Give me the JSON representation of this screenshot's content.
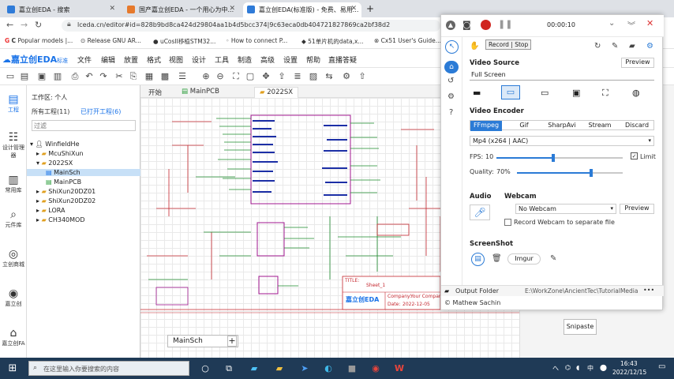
{
  "browser": {
    "tabs": [
      {
        "title": "嘉立创EDA - 搜索"
      },
      {
        "title": "国产嘉立创EDA - 一个用心为中..."
      },
      {
        "title": "嘉立创EDA(标准版) - 免费、易用..."
      }
    ],
    "new_tab": "+",
    "address": "lceda.cn/editor#id=828b9bd8ca424d29804aa1b4d5bcc374|9c63eca0db4047218278​69ca2bf38d2",
    "bookmarks": [
      "Popular models |...",
      "Release GNU AR...",
      "uCosII移植STM32...",
      "How to connect P...",
      "51单片机的data,x...",
      "Cx51 User's Guide..."
    ]
  },
  "eda": {
    "logo": "嘉立创EDA",
    "logo_tag": "标准",
    "menu": [
      "文件",
      "编辑",
      "放置",
      "格式",
      "视图",
      "设计",
      "工具",
      "制造",
      "高级",
      "设置",
      "帮助",
      "直播答疑"
    ],
    "rail": [
      {
        "label": "工程",
        "icon": "folder-icon"
      },
      {
        "label": "设计管理器",
        "icon": "list-icon"
      },
      {
        "label": "常用库",
        "icon": "library-icon"
      },
      {
        "label": "元件库",
        "icon": "search-icon"
      },
      {
        "label": "立创商城",
        "icon": "store-icon"
      },
      {
        "label": "嘉立创",
        "icon": "jlc-icon"
      },
      {
        "label": "嘉立创FA",
        "icon": "factory-icon"
      }
    ],
    "workspace_label": "工作区: 个人",
    "projects_all": "所有工程(11)",
    "projects_open": "已打开工程(6)",
    "filter_placeholder": "过滤",
    "tree": [
      {
        "label": "WinfieldHe",
        "level": 0,
        "expanded": true
      },
      {
        "label": "McuShiXun",
        "level": 1
      },
      {
        "label": "2022SX",
        "level": 1,
        "expanded": true
      },
      {
        "label": "MainSch",
        "level": 2,
        "selected": true
      },
      {
        "label": "MainPCB",
        "level": 2
      },
      {
        "label": "ShiXun20DZ01",
        "level": 1
      },
      {
        "label": "ShiXun20DZ02",
        "level": 1
      },
      {
        "label": "LORA",
        "level": 1
      },
      {
        "label": "CH340MOD",
        "level": 1
      }
    ],
    "doc_tabs": [
      "开始",
      "MainPCB",
      "2022SX"
    ],
    "bottom_tab": "MainSch",
    "bottom_add": "+",
    "title_block": {
      "title": "TITLE:",
      "sheet": "Sheet_1",
      "company_label": "Company:",
      "company": "Your Compan",
      "date_label": "Date:",
      "date": "2022-12-05",
      "logo": "嘉立创EDA"
    }
  },
  "recorder": {
    "time": "00:00:10",
    "tooltip": "Record | Stop",
    "video_source_label": "Video Source",
    "preview_label": "Preview",
    "source_value": "Full Screen",
    "video_encoder_label": "Video Encoder",
    "encoders": [
      "FFmpeg",
      "Gif",
      "SharpAvi",
      "Stream",
      "Discard"
    ],
    "encoder_selected": "FFmpeg",
    "format": "Mp4 (x264 | AAC)",
    "fps_label": "FPS:",
    "fps_value": "10",
    "fps_level": 0.45,
    "limit_label": "Limit",
    "limit_checked": true,
    "quality_label": "Quality:",
    "quality_value": "70%",
    "quality_level": 0.7,
    "audio_label": "Audio",
    "webcam_label": "Webcam",
    "webcam_value": "No Webcam",
    "webcam_preview": "Preview",
    "record_webcam_label": "Record Webcam to separate file",
    "screenshot_label": "ScreenShot",
    "imgur_label": "Imgur",
    "output_folder_label": "Output Folder",
    "output_folder_value": "E:\\WorkZone\\AncientTec\\TutorialMedia",
    "more": "•••",
    "author": "© Mathew Sachin"
  },
  "snipaste": "Snipaste",
  "taskbar": {
    "search_placeholder": "在这里输入你要搜索的内容",
    "tray_temp": "へ",
    "tray_lang": "中",
    "time": "16:43",
    "date": "2022/12/15"
  },
  "colors": {
    "accent": "#1a73e8",
    "recorder_blue": "#2b7bd6",
    "taskbar": "#1f3a56",
    "schematic_red": "#c4262e",
    "schematic_blue": "#1c2fa6",
    "schematic_purple": "#a0178f"
  }
}
